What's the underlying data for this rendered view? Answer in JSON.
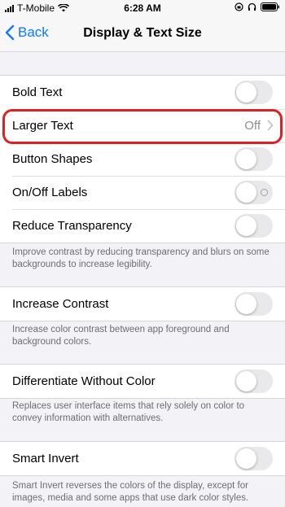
{
  "status": {
    "carrier": "T-Mobile",
    "time": "6:28 AM"
  },
  "nav": {
    "back_label": "Back",
    "title": "Display & Text Size"
  },
  "group1": {
    "bold_text": "Bold Text",
    "larger_text": "Larger Text",
    "larger_text_value": "Off",
    "button_shapes": "Button Shapes",
    "onoff_labels": "On/Off Labels",
    "reduce_transparency": "Reduce Transparency"
  },
  "footer1": "Improve contrast by reducing transparency and blurs on some backgrounds to increase legibility.",
  "group2": {
    "increase_contrast": "Increase Contrast"
  },
  "footer2": "Increase color contrast between app foreground and background colors.",
  "group3": {
    "differentiate": "Differentiate Without Color"
  },
  "footer3": "Replaces user interface items that rely solely on color to convey information with alternatives.",
  "group4": {
    "smart_invert": "Smart Invert"
  },
  "footer4": "Smart Invert reverses the colors of the display, except for images, media and some apps that use dark color styles.",
  "colors": {
    "accent": "#0a7aff",
    "highlight": "#e02020"
  },
  "icons": [
    "signal-icon",
    "wifi-icon",
    "lock-rotation-icon",
    "headphones-icon",
    "battery-icon",
    "chevron-left-icon",
    "chevron-right-icon"
  ]
}
